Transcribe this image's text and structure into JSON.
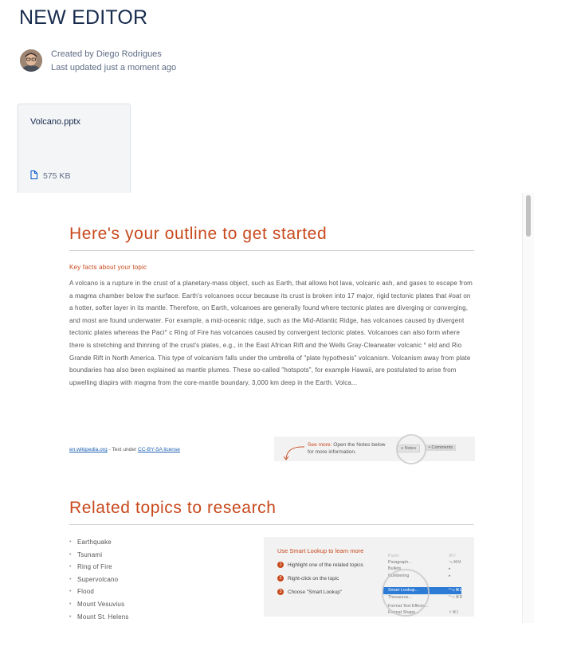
{
  "page": {
    "title": "NEW EDITOR",
    "created_by": "Created by Diego Rodrigues",
    "last_updated": "Last updated just a moment ago"
  },
  "attachment": {
    "file_name": "Volcano.pptx",
    "file_size": "575 KB",
    "icon": "file-icon"
  },
  "slide": {
    "heading": "Here's your outline to get started",
    "subheading": "Key facts about your topic",
    "body": "A volcano is a rupture in the crust of a planetary-mass object, such as Earth, that allows hot lava, volcanic ash, and gases to escape from a magma chamber below the surface. Earth's volcanoes occur because its crust is broken into 17 major, rigid tectonic plates that #oat on a hotter, softer layer in its mantle. Therefore, on Earth, volcanoes are generally found where tectonic plates are diverging or converging, and most are found underwater. For example, a mid-oceanic ridge, such as the Mid-Atlantic Ridge, has volcanoes caused by divergent tectonic plates whereas the Paci° c Ring of Fire has volcanoes caused by convergent tectonic plates. Volcanoes can also form where there is stretching and thinning of the crust's plates, e.g., in the East African Rift and the Wells Gray-Clearwater volcanic ° eld and Rio Grande Rift in North America. This type of volcanism falls under the umbrella of \"plate hypothesis\" volcanism. Volcanism away from plate boundaries has also been explained as mantle plumes. These so-called \"hotspots\", for example Hawaii, are postulated to arise from upwelling diapirs with magma from the core-mantle boundary, 3,000 km deep in the Earth. Volca...",
    "source_link": "en.wikipedia.org",
    "source_mid": " - Text under ",
    "license_link": "CC-BY-SA license",
    "see_more_label": "See more:",
    "see_more_text": " Open the Notes below for more information.",
    "notes_label": "Notes",
    "comments_label": "Comments",
    "related_heading": "Related topics to research",
    "topics": [
      "Earthquake",
      "Tsunami",
      "Ring of Fire",
      "Supervolcano",
      "Flood",
      "Mount Vesuvius",
      "Mount St. Helens"
    ],
    "lookup": {
      "title": "Use Smart Lookup to learn more",
      "steps": [
        {
          "num": "1",
          "text": "Highlight one of the related topics"
        },
        {
          "num": "2",
          "text": "Right-click on the topic"
        },
        {
          "num": "3",
          "text": "Choose \"Smart Lookup\""
        }
      ],
      "menu": [
        {
          "label": "Paste",
          "shortcut": "⌘V"
        },
        {
          "label": "Paragraph...",
          "shortcut": "⌥⌘M"
        },
        {
          "label": "Bullets",
          "shortcut": "▸"
        },
        {
          "label": "Numbering",
          "shortcut": "▸"
        },
        {
          "label": "Smart Lookup...",
          "shortcut": "^⌥⌘L"
        },
        {
          "label": "Thesaurus...",
          "shortcut": "^⌥⌘R"
        },
        {
          "label": "Format Text Effects...",
          "shortcut": ""
        },
        {
          "label": "Format Shape...",
          "shortcut": "⇧⌘1"
        }
      ]
    }
  }
}
